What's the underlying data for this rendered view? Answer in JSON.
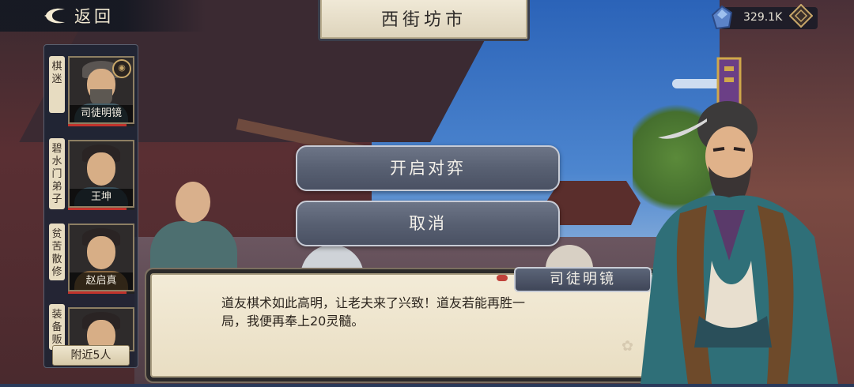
{
  "topbar": {
    "back_label": "返回",
    "title": "西街坊市",
    "currency_value": "329.1K"
  },
  "sidebar": {
    "categories": [
      "棋迷",
      "碧水门弟子",
      "贫苦散修",
      "装备贩"
    ],
    "npcs": [
      {
        "name": "司徒明镜"
      },
      {
        "name": "王坤"
      },
      {
        "name": "赵启真"
      },
      {
        "name": ""
      }
    ],
    "nearby_label": "附近5人"
  },
  "options": [
    {
      "label": "开启对弈"
    },
    {
      "label": "取消"
    }
  ],
  "dialog": {
    "speaker": "司徒明镜",
    "line1": "道友棋术如此高明，让老夫来了兴致！道友若能再胜一",
    "line2": "局，我便再奉上20灵髓。"
  },
  "colors": {
    "button": "#586072",
    "dialog_bg": "#f3ebd7",
    "hp": "#c1332c"
  }
}
